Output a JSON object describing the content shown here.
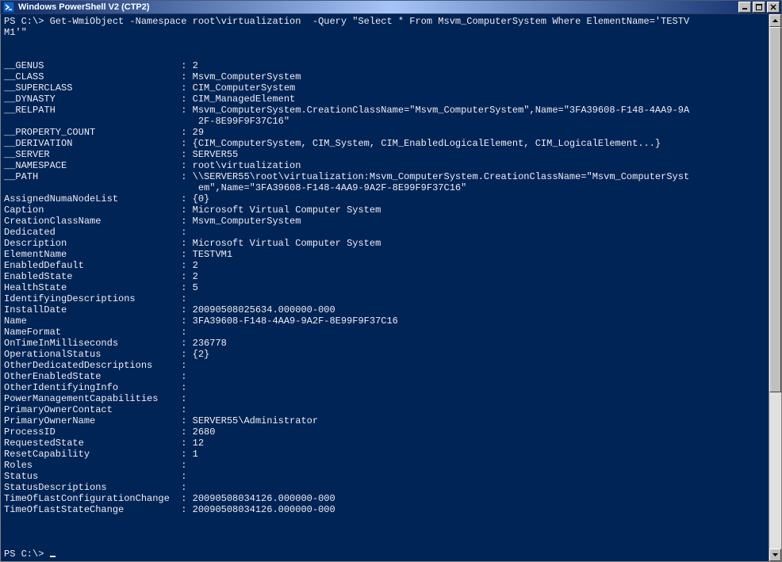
{
  "window": {
    "title": "Windows PowerShell V2 (CTP2)"
  },
  "prompt1": "PS C:\\> ",
  "command1": "Get-WmiObject -Namespace root\\virtualization  -Query \"Select * From Msvm_ComputerSystem Where ElementName='TESTV\nM1'\"",
  "blank2": "",
  "props": [
    {
      "k": "__GENUS",
      "v": "2"
    },
    {
      "k": "__CLASS",
      "v": "Msvm_ComputerSystem"
    },
    {
      "k": "__SUPERCLASS",
      "v": "CIM_ComputerSystem"
    },
    {
      "k": "__DYNASTY",
      "v": "CIM_ManagedElement"
    },
    {
      "k": "__RELPATH",
      "v": "Msvm_ComputerSystem.CreationClassName=\"Msvm_ComputerSystem\",Name=\"3FA39608-F148-4AA9-9A\n                                  2F-8E99F9F37C16\""
    },
    {
      "k": "__PROPERTY_COUNT",
      "v": "29"
    },
    {
      "k": "__DERIVATION",
      "v": "{CIM_ComputerSystem, CIM_System, CIM_EnabledLogicalElement, CIM_LogicalElement...}"
    },
    {
      "k": "__SERVER",
      "v": "SERVER55"
    },
    {
      "k": "__NAMESPACE",
      "v": "root\\virtualization"
    },
    {
      "k": "__PATH",
      "v": "\\\\SERVER55\\root\\virtualization:Msvm_ComputerSystem.CreationClassName=\"Msvm_ComputerSyst\n                                  em\",Name=\"3FA39608-F148-4AA9-9A2F-8E99F9F37C16\""
    },
    {
      "k": "AssignedNumaNodeList",
      "v": "{0}"
    },
    {
      "k": "Caption",
      "v": "Microsoft Virtual Computer System"
    },
    {
      "k": "CreationClassName",
      "v": "Msvm_ComputerSystem"
    },
    {
      "k": "Dedicated",
      "v": ""
    },
    {
      "k": "Description",
      "v": "Microsoft Virtual Computer System"
    },
    {
      "k": "ElementName",
      "v": "TESTVM1"
    },
    {
      "k": "EnabledDefault",
      "v": "2"
    },
    {
      "k": "EnabledState",
      "v": "2"
    },
    {
      "k": "HealthState",
      "v": "5"
    },
    {
      "k": "IdentifyingDescriptions",
      "v": ""
    },
    {
      "k": "InstallDate",
      "v": "20090508025634.000000-000"
    },
    {
      "k": "Name",
      "v": "3FA39608-F148-4AA9-9A2F-8E99F9F37C16"
    },
    {
      "k": "NameFormat",
      "v": ""
    },
    {
      "k": "OnTimeInMilliseconds",
      "v": "236778"
    },
    {
      "k": "OperationalStatus",
      "v": "{2}"
    },
    {
      "k": "OtherDedicatedDescriptions",
      "v": ""
    },
    {
      "k": "OtherEnabledState",
      "v": ""
    },
    {
      "k": "OtherIdentifyingInfo",
      "v": ""
    },
    {
      "k": "PowerManagementCapabilities",
      "v": ""
    },
    {
      "k": "PrimaryOwnerContact",
      "v": ""
    },
    {
      "k": "PrimaryOwnerName",
      "v": "SERVER55\\Administrator"
    },
    {
      "k": "ProcessID",
      "v": "2680"
    },
    {
      "k": "RequestedState",
      "v": "12"
    },
    {
      "k": "ResetCapability",
      "v": "1"
    },
    {
      "k": "Roles",
      "v": ""
    },
    {
      "k": "Status",
      "v": ""
    },
    {
      "k": "StatusDescriptions",
      "v": ""
    },
    {
      "k": "TimeOfLastConfigurationChange",
      "v": "20090508034126.000000-000"
    },
    {
      "k": "TimeOfLastStateChange",
      "v": "20090508034126.000000-000"
    }
  ],
  "prompt2": "PS C:\\> "
}
